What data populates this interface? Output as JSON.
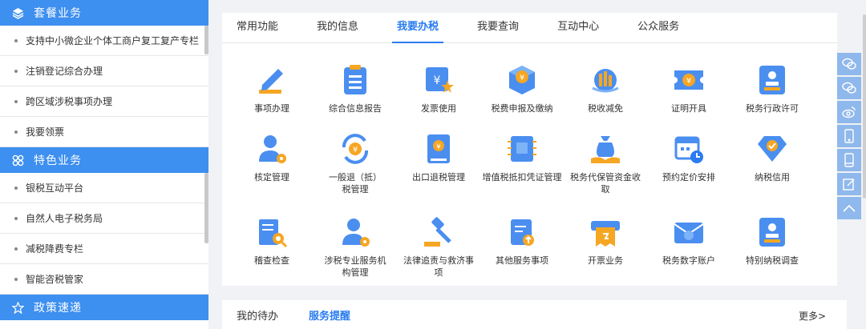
{
  "sidebar": {
    "sections": [
      {
        "title": "套餐业务",
        "icon": "layers-icon",
        "items": [
          "支持中小微企业个体工商户复工复产专栏",
          "注销登记综合办理",
          "跨区域涉税事项办理",
          "我要领票"
        ]
      },
      {
        "title": "特色业务",
        "icon": "clover-icon",
        "items": [
          "银税互动平台",
          "自然人电子税务局",
          "减税降费专栏",
          "智能咨税管家"
        ]
      },
      {
        "title": "政策速递",
        "icon": "star-icon",
        "items": []
      }
    ]
  },
  "main": {
    "tabs": [
      "常用功能",
      "我的信息",
      "我要办税",
      "我要查询",
      "互动中心",
      "公众服务"
    ],
    "active_tab": "我要办税",
    "functions": [
      {
        "label": "事项办理",
        "icon": "pen-icon"
      },
      {
        "label": "综合信息报告",
        "icon": "clipboard-list-icon"
      },
      {
        "label": "发票使用",
        "icon": "invoice-star-icon"
      },
      {
        "label": "税费申报及缴纳",
        "icon": "yuan-box-icon"
      },
      {
        "label": "税收减免",
        "icon": "coin-stack-icon"
      },
      {
        "label": "证明开具",
        "icon": "ticket-yuan-icon"
      },
      {
        "label": "税务行政许可",
        "icon": "stamp-icon"
      },
      {
        "label": "核定管理",
        "icon": "user-gear-icon"
      },
      {
        "label": "一般退（抵）税管理",
        "icon": "refund-cycle-icon"
      },
      {
        "label": "出口退税管理",
        "icon": "book-yuan-icon"
      },
      {
        "label": "增值税抵扣凭证管理",
        "icon": "ticket-zeng-icon"
      },
      {
        "label": "税务代保管资金收取",
        "icon": "money-bag-icon"
      },
      {
        "label": "预约定价安排",
        "icon": "calendar-clock-icon"
      },
      {
        "label": "纳税信用",
        "icon": "diamond-check-icon"
      },
      {
        "label": "稽查检查",
        "icon": "doc-search-icon"
      },
      {
        "label": "涉税专业服务机构管理",
        "icon": "user-gear-icon"
      },
      {
        "label": "法律追责与救济事项",
        "icon": "gavel-icon"
      },
      {
        "label": "其他服务事项",
        "icon": "clipboard-upload-icon"
      },
      {
        "label": "开票业务",
        "icon": "receipt-printer-icon"
      },
      {
        "label": "税务数字账户",
        "icon": "mail-user-icon"
      },
      {
        "label": "特别纳税调查",
        "icon": "stamp-icon"
      }
    ]
  },
  "bottom": {
    "tabs": [
      "我的待办",
      "服务提醒"
    ],
    "active_tab": "服务提醒",
    "more_label": "更多>"
  },
  "right_toolbar": [
    "chat-icon",
    "chat-icon",
    "weibo-icon",
    "mobile-icon",
    "tablet-icon",
    "edit-icon",
    "arrow-up-icon"
  ],
  "colors": {
    "accent": "#3d8ff0",
    "tab_active": "#2a7cf0",
    "icon_blue": "#4a8ef0",
    "icon_orange": "#f5a623",
    "toolbar": "#8fb8ec"
  }
}
